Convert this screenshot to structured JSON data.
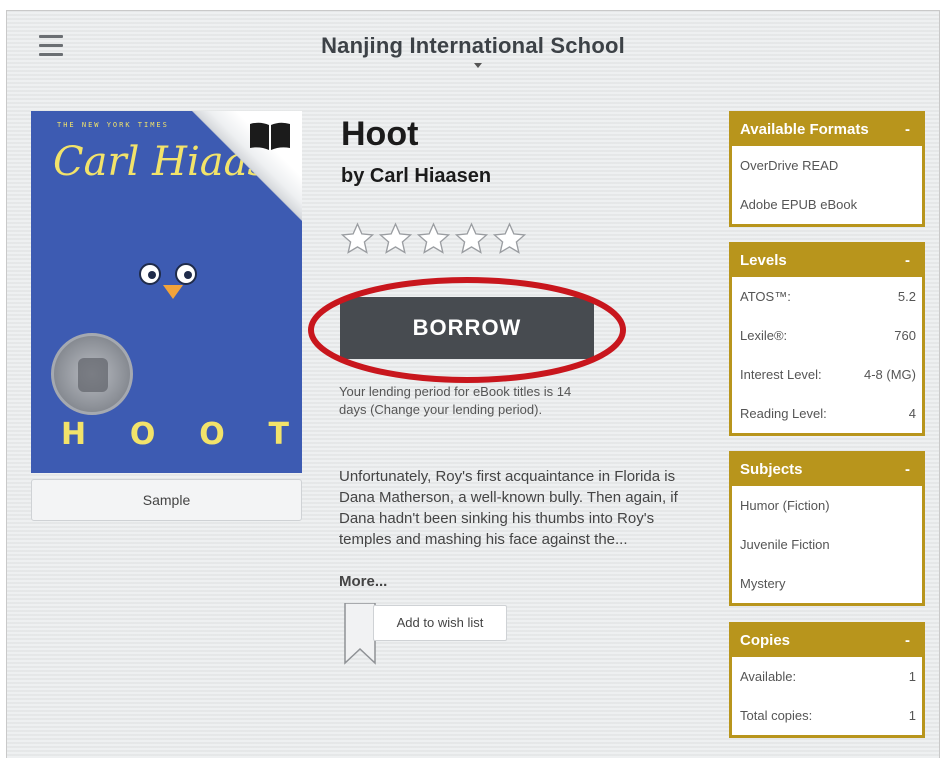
{
  "header": {
    "library_name": "Nanjing International School"
  },
  "cover": {
    "top_text": "THE NEW YORK TIMES",
    "author_text": "Carl Hiaasen",
    "title_letters": [
      "H",
      "O",
      "O",
      "T"
    ],
    "background_color": "#3d5bb2",
    "accent_color": "#f2e36a"
  },
  "sample_button": {
    "label": "Sample"
  },
  "book": {
    "title": "Hoot",
    "by_prefix": "by",
    "author": "Carl Hiaasen",
    "rating": {
      "filled": 0,
      "max": 5
    }
  },
  "borrow_button": {
    "label": "BORROW",
    "color": "#474b50"
  },
  "lending_note": {
    "text": "Your lending period for eBook titles is 14 days (Change your lending period)."
  },
  "description": {
    "text": "Unfortunately, Roy's first acquaintance in Florida is Dana Matherson, a well-known bully. Then again, if Dana hadn't been sinking his thumbs into Roy's temples and mashing his face against the...",
    "more_label": "More..."
  },
  "wish_list": {
    "label": "Add to wish list"
  },
  "panels": {
    "accent_color": "#b8951c",
    "formats": {
      "title": "Available Formats",
      "toggle": "-",
      "items": [
        "OverDrive READ",
        "Adobe EPUB eBook"
      ]
    },
    "levels": {
      "title": "Levels",
      "toggle": "-",
      "rows": [
        {
          "label": "ATOS™:",
          "value": "5.2"
        },
        {
          "label": "Lexile®:",
          "value": "760"
        },
        {
          "label": "Interest Level:",
          "value": "4-8 (MG)"
        },
        {
          "label": "Reading Level:",
          "value": "4"
        }
      ]
    },
    "subjects": {
      "title": "Subjects",
      "toggle": "-",
      "items": [
        "Humor (Fiction)",
        "Juvenile Fiction",
        "Mystery"
      ]
    },
    "copies": {
      "title": "Copies",
      "toggle": "-",
      "rows": [
        {
          "label": "Available:",
          "value": "1"
        },
        {
          "label": "Total copies:",
          "value": "1"
        }
      ]
    }
  },
  "annotation": {
    "highlight_color": "#c8161d"
  }
}
